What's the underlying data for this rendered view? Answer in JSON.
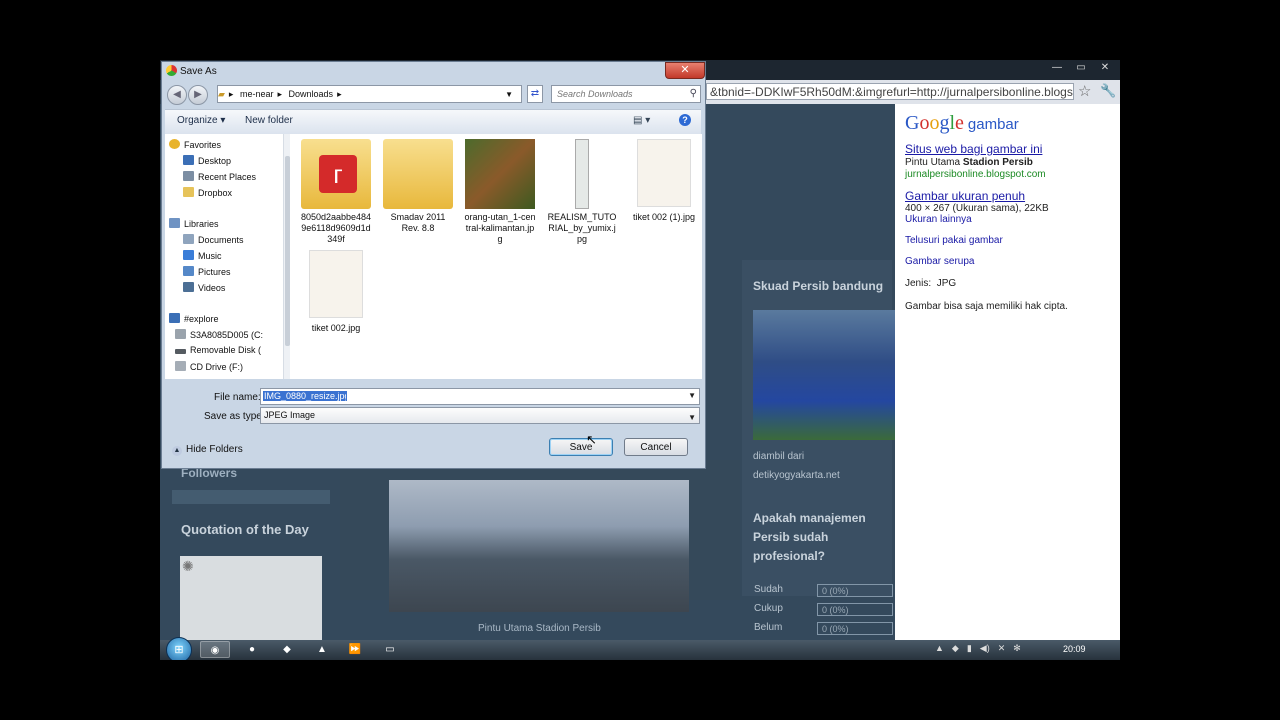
{
  "browser": {
    "address": "&tbnid=-DDKIwF5Rh50dM:&imgrefurl=http://jurnalpersibonline.blogspot",
    "star_icon": "star-icon",
    "wrench_icon": "wrench-icon"
  },
  "website": {
    "skuad_title": "Skuad Persib bandung",
    "skuad_caption_1": "diambil dari",
    "skuad_caption_2": "detikyogyakarta.net",
    "poll_title": "Apakah manajemen Persib sudah profesional?",
    "poll_options": [
      {
        "label": "Sudah",
        "value": "0 (0%)"
      },
      {
        "label": "Cukup",
        "value": "0 (0%)"
      },
      {
        "label": "Belum",
        "value": "0 (0%)"
      }
    ],
    "followers_title": "Followers",
    "quote_title": "Quotation of the Day",
    "stadium_caption": "Pintu Utama Stadion Persib"
  },
  "google": {
    "logo": "Google",
    "logo_sub": "gambar",
    "link_site": "Situs web bagi gambar ini",
    "site_desc_1": "Pintu Utama",
    "site_desc_2": "Stadion Persib",
    "site_url": "jurnalpersibonline.blogspot.com",
    "link_full": "Gambar ukuran penuh",
    "full_desc": "400 × 267 (Ukuran sama), 22KB",
    "link_other_sizes": "Ukuran lainnya",
    "link_search_by_image": "Telusuri pakai gambar",
    "link_similar": "Gambar serupa",
    "type_label": "Jenis:",
    "type_value": "JPG",
    "copyright": "Gambar bisa saja memiliki hak cipta."
  },
  "dialog": {
    "title": "Save As",
    "breadcrumb": [
      "me-near",
      "Downloads"
    ],
    "search_placeholder": "Search Downloads",
    "toolbar": {
      "organize": "Organize",
      "new_folder": "New folder"
    },
    "nav_items": [
      {
        "label": "Favorites",
        "icon": "star-icon",
        "color": "#e8b32b"
      },
      {
        "label": "Desktop",
        "icon": "desktop-icon",
        "color": "#3b6fb6"
      },
      {
        "label": "Recent Places",
        "icon": "recent-places-icon",
        "color": "#7c8ea3"
      },
      {
        "label": "Dropbox",
        "icon": "dropbox-folder-icon",
        "color": "#e6c35a"
      },
      {
        "label": "Libraries",
        "icon": "libraries-icon",
        "color": "#6f93c3"
      },
      {
        "label": "Documents",
        "icon": "documents-icon",
        "color": "#8fa4bd"
      },
      {
        "label": "Music",
        "icon": "music-icon",
        "color": "#3a7dd8"
      },
      {
        "label": "Pictures",
        "icon": "pictures-icon",
        "color": "#5588c8"
      },
      {
        "label": "Videos",
        "icon": "videos-icon",
        "color": "#4c6f95"
      },
      {
        "label": "#explore",
        "icon": "network-icon",
        "color": "#3b6fb6"
      },
      {
        "label": "S3A8085D005 (C:",
        "icon": "drive-icon",
        "color": "#9aa3ac"
      },
      {
        "label": "Removable Disk (",
        "icon": "removable-disk-icon",
        "color": "#555b61"
      },
      {
        "label": "CD Drive (F:)",
        "icon": "cd-drive-icon",
        "color": "#a5adb6"
      }
    ],
    "files": [
      {
        "name": "8050d2aabbe4849e6118d9609d1d349f",
        "kind": "folder-app"
      },
      {
        "name": "Smadav 2011 Rev. 8.8",
        "kind": "folder"
      },
      {
        "name": "orang-utan_1-central-kalimantan.jpg",
        "kind": "photo"
      },
      {
        "name": "REALISM_TUTORIAL_by_yumix.jpg",
        "kind": "thin"
      },
      {
        "name": "tiket 002 (1).jpg",
        "kind": "paper"
      },
      {
        "name": "tiket 002.jpg",
        "kind": "paper"
      }
    ],
    "filename_label": "File name:",
    "filename_value": "IMG_0880_resize.jpg",
    "savetype_label": "Save as type:",
    "savetype_value": "JPEG Image",
    "hide_folders": "Hide Folders",
    "save": "Save",
    "cancel": "Cancel"
  },
  "taskbar": {
    "clock": "20:09"
  }
}
